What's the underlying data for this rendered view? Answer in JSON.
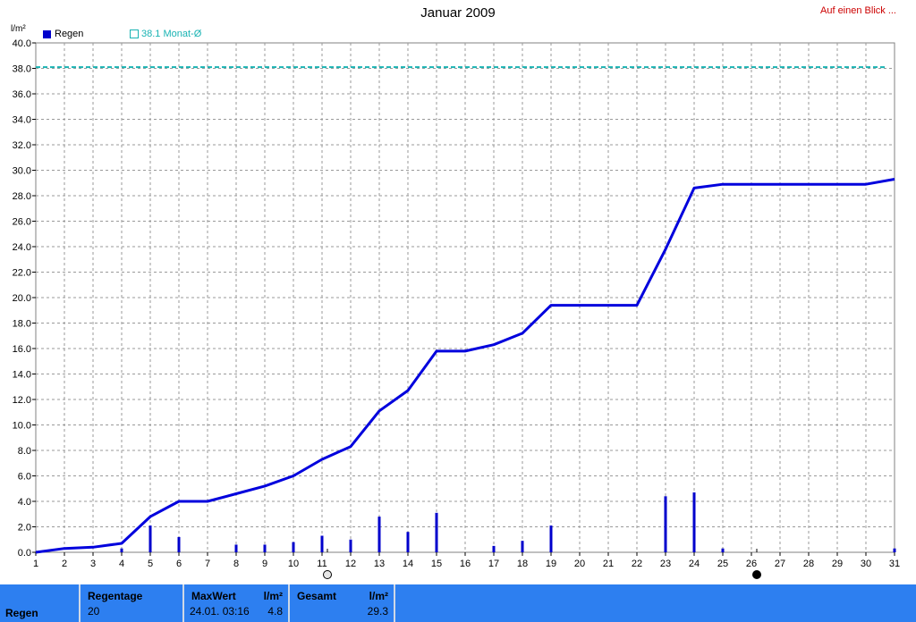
{
  "page": {
    "title": "Januar 2009",
    "link": "Auf einen Blick ...",
    "legend_rain": "Regen",
    "legend_avg": "38.1 Monat-Ø"
  },
  "chart_data": {
    "type": "bar",
    "ylabel": "l/m²",
    "ylim": [
      0,
      40
    ],
    "yticks": [
      "0.0",
      "2.0",
      "4.0",
      "6.0",
      "8.0",
      "10.0",
      "12.0",
      "14.0",
      "16.0",
      "18.0",
      "20.0",
      "22.0",
      "24.0",
      "26.0",
      "28.0",
      "30.0",
      "32.0",
      "34.0",
      "36.0",
      "38.0",
      "40.0"
    ],
    "x": [
      1,
      2,
      3,
      4,
      5,
      6,
      7,
      8,
      9,
      10,
      11,
      12,
      13,
      14,
      15,
      16,
      17,
      18,
      19,
      20,
      21,
      22,
      23,
      24,
      25,
      26,
      27,
      28,
      29,
      30,
      31
    ],
    "xtick_labels": [
      "1",
      "2",
      "3",
      "4",
      "5",
      "6",
      "7",
      "8",
      "9",
      "10",
      "11",
      "12",
      "13",
      "14",
      "15",
      "16",
      "17",
      "18",
      "19",
      "20",
      "21",
      "22",
      "23",
      "24",
      "25",
      "26",
      "27",
      "28",
      "29",
      "30",
      "31"
    ],
    "grid": true,
    "legend_position": "top-left",
    "series": [
      {
        "name": "Regen",
        "type": "bar",
        "color": "#0000cc",
        "points": [
          [
            4,
            0.3
          ],
          [
            5,
            2.1
          ],
          [
            6,
            1.2
          ],
          [
            8,
            0.6
          ],
          [
            9,
            0.6
          ],
          [
            10,
            0.8
          ],
          [
            11,
            1.3
          ],
          [
            12,
            1.0
          ],
          [
            13,
            2.8
          ],
          [
            14,
            1.6
          ],
          [
            15,
            3.1
          ],
          [
            17,
            0.5
          ],
          [
            18,
            0.9
          ],
          [
            19,
            2.1
          ],
          [
            23,
            4.4
          ],
          [
            24,
            4.7
          ],
          [
            25,
            0.3
          ],
          [
            31,
            0.3
          ]
        ]
      },
      {
        "name": "Regen",
        "type": "line",
        "color": "#0000dd",
        "points": [
          [
            1,
            0.0
          ],
          [
            2,
            0.3
          ],
          [
            3,
            0.4
          ],
          [
            4,
            0.7
          ],
          [
            5,
            2.8
          ],
          [
            6,
            4.0
          ],
          [
            7,
            4.0
          ],
          [
            8,
            4.6
          ],
          [
            9,
            5.2
          ],
          [
            10,
            6.0
          ],
          [
            11,
            7.3
          ],
          [
            12,
            8.3
          ],
          [
            13,
            11.1
          ],
          [
            14,
            12.7
          ],
          [
            15,
            15.8
          ],
          [
            16,
            15.8
          ],
          [
            17,
            16.3
          ],
          [
            18,
            17.2
          ],
          [
            19,
            19.4
          ],
          [
            20,
            19.4
          ],
          [
            21,
            19.4
          ],
          [
            22,
            19.4
          ],
          [
            23,
            23.8
          ],
          [
            24,
            28.6
          ],
          [
            25,
            28.9
          ],
          [
            26,
            28.9
          ],
          [
            27,
            28.9
          ],
          [
            28,
            28.9
          ],
          [
            29,
            28.9
          ],
          [
            30,
            28.9
          ],
          [
            31,
            29.3
          ]
        ]
      },
      {
        "name": "38.1 Monat-Ø",
        "type": "dashed-line",
        "color": "#19b3b3",
        "value": 38.1
      }
    ],
    "moon_markers": [
      {
        "day": 11,
        "phase": "full-moon"
      },
      {
        "day": 26,
        "phase": "new-moon"
      }
    ]
  },
  "footer": {
    "label": "Regen",
    "regentage": {
      "label": "Regentage",
      "value": "20"
    },
    "maxwert": {
      "label": "MaxWert",
      "unit": "l/m²",
      "date": "24.01.  03:16",
      "value": "4.8"
    },
    "gesamt": {
      "label": "Gesamt",
      "unit": "l/m²",
      "value": "29.3"
    }
  }
}
